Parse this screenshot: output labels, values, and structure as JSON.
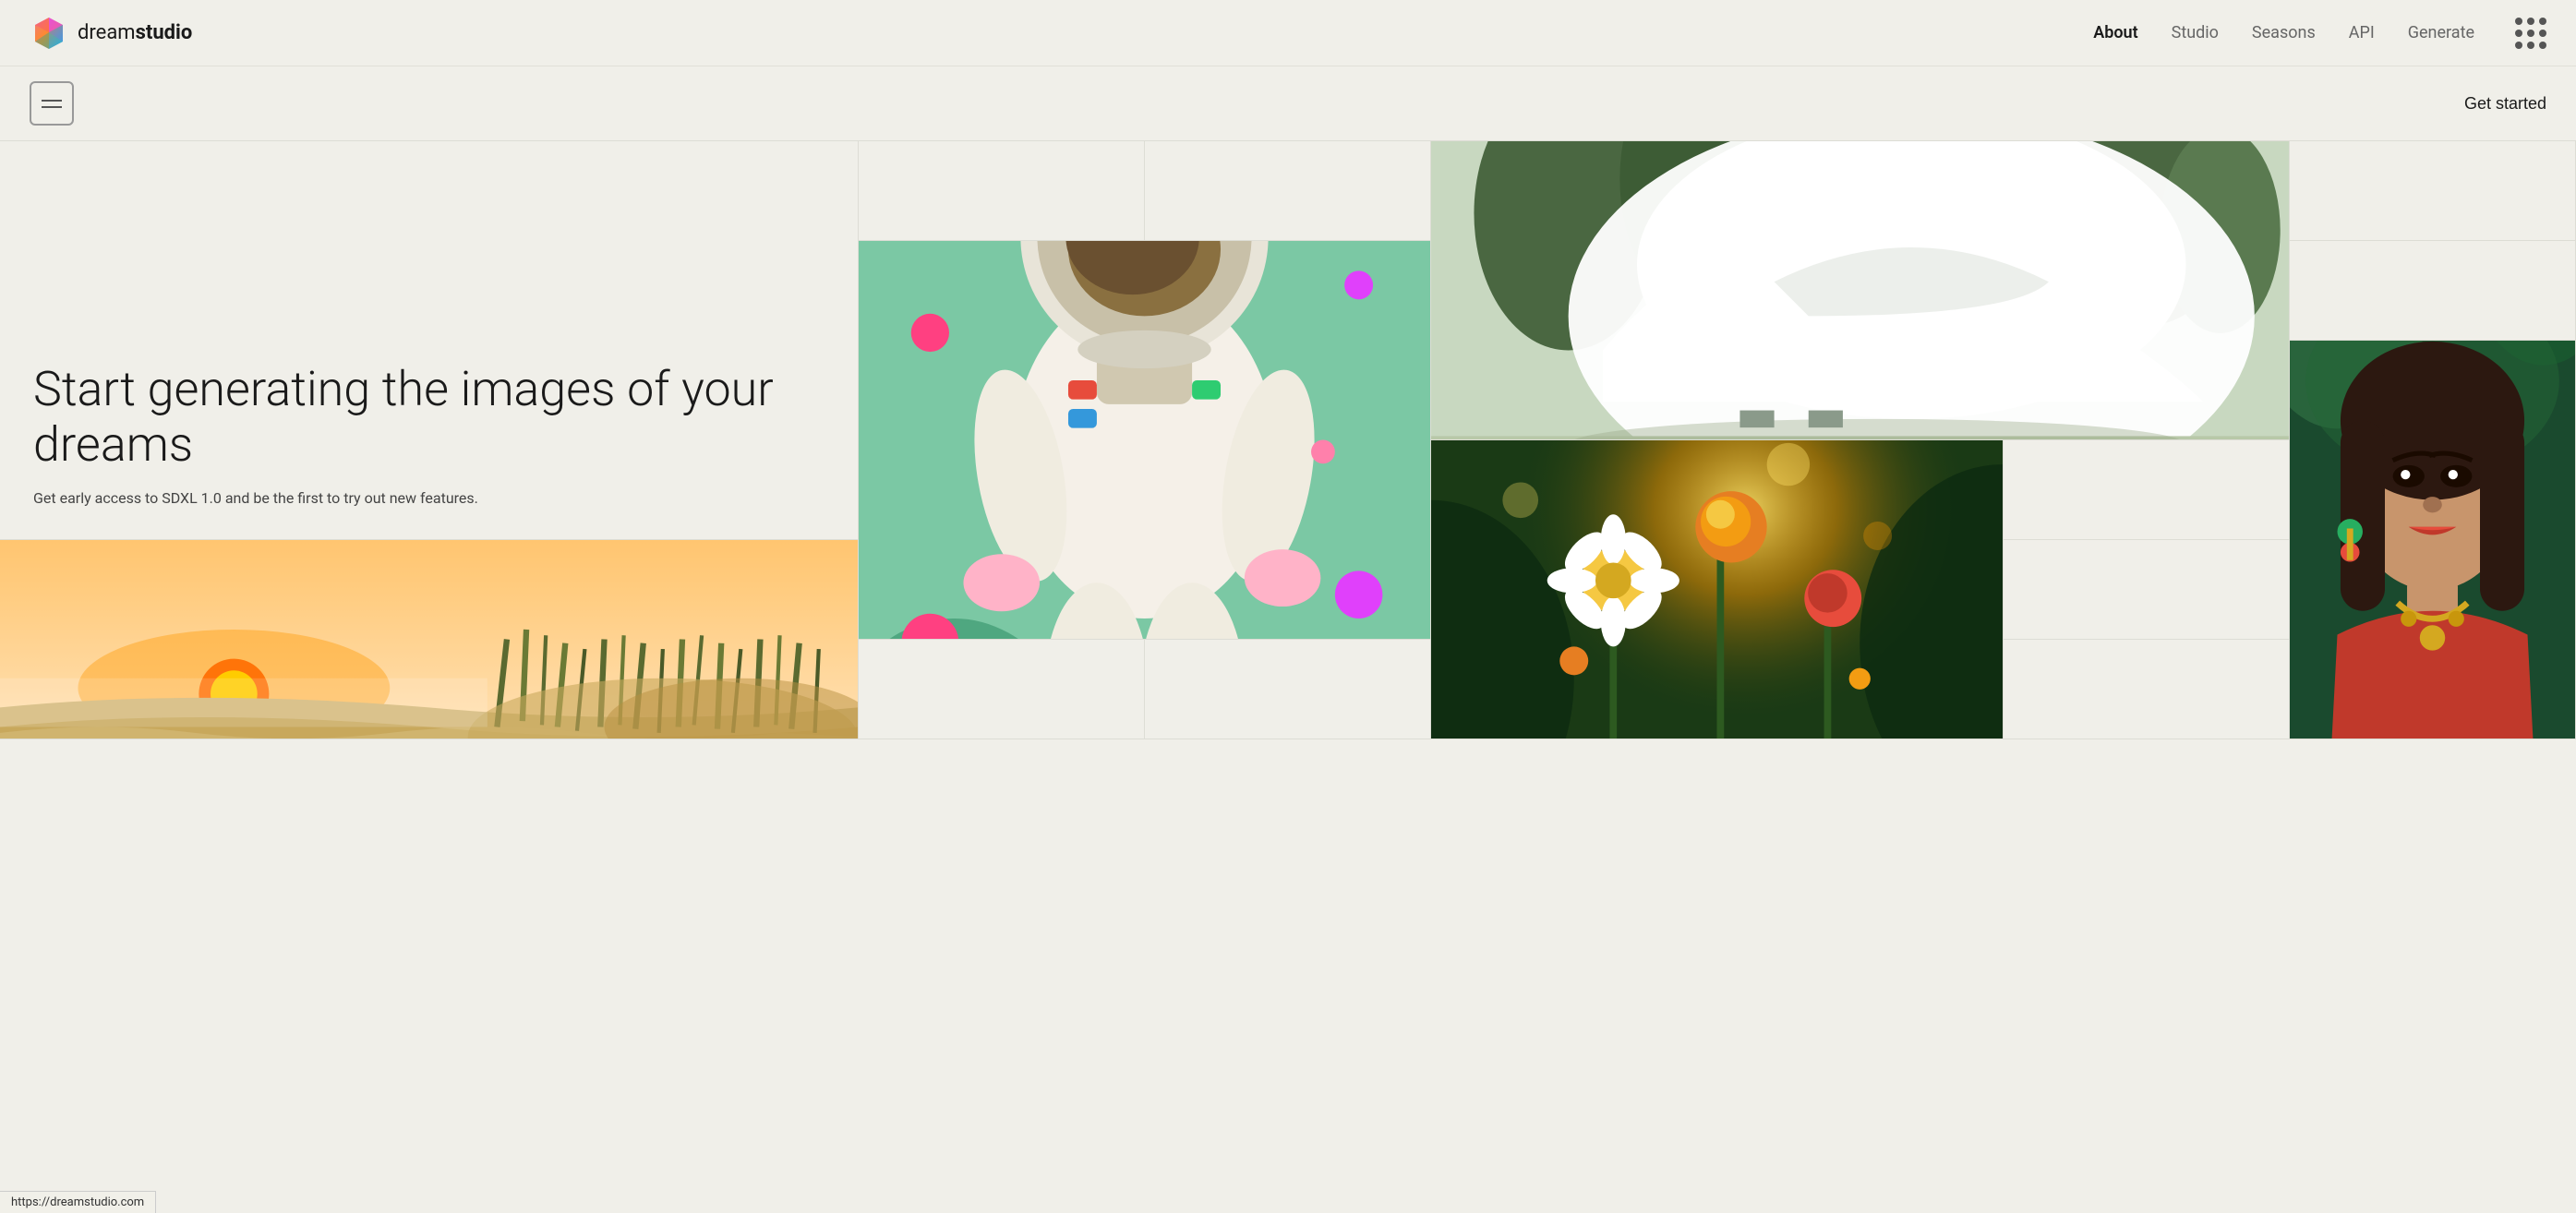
{
  "header": {
    "logo_text_light": "dream",
    "logo_text_bold": "studio",
    "nav": {
      "about_label": "About",
      "studio_label": "Studio",
      "seasons_label": "Seasons",
      "api_label": "API",
      "generate_label": "Generate"
    }
  },
  "sub_header": {
    "get_started_label": "Get started"
  },
  "hero": {
    "title": "Start generating the images of your dreams",
    "subtitle": "Get early access to SDXL 1.0 and be the first\nto try out new features."
  },
  "url_bar": {
    "url": "https://dreamstudio.com"
  },
  "images": {
    "astronaut_alt": "Astronaut in spacesuit surrounded by pink roses and flowers on green background",
    "architecture_alt": "Modern white curved architecture building with trees",
    "flowers_alt": "Close up of daisy and orange flowers in sunlit garden",
    "portrait_alt": "Woman with colorful flower crown and traditional jewelry portrait",
    "beach_alt": "Sandy beach dunes at golden sunset with grass"
  }
}
